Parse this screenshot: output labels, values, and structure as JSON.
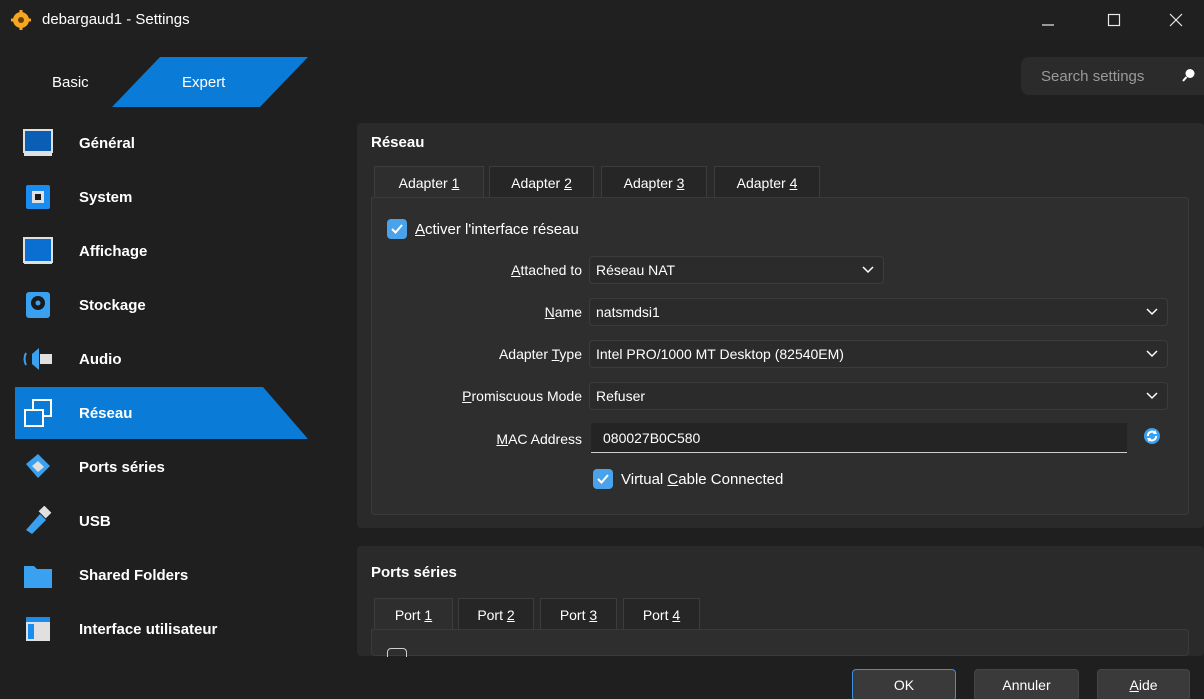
{
  "window": {
    "title": "debargaud1 - Settings"
  },
  "mode": {
    "basic": "Basic",
    "expert": "Expert"
  },
  "search": {
    "placeholder": "Search settings"
  },
  "sidebar": {
    "items": [
      {
        "label": "Général",
        "icon": "monitor-icon"
      },
      {
        "label": "System",
        "icon": "chip-icon"
      },
      {
        "label": "Affichage",
        "icon": "display-icon"
      },
      {
        "label": "Stockage",
        "icon": "disk-icon"
      },
      {
        "label": "Audio",
        "icon": "speaker-icon"
      },
      {
        "label": "Réseau",
        "icon": "network-icon",
        "selected": true
      },
      {
        "label": "Ports séries",
        "icon": "serial-port-icon"
      },
      {
        "label": "USB",
        "icon": "usb-icon"
      },
      {
        "label": "Shared Folders",
        "icon": "folder-icon"
      },
      {
        "label": "Interface utilisateur",
        "icon": "ui-window-icon"
      }
    ]
  },
  "network": {
    "title": "Réseau",
    "tabs": [
      {
        "prefix": "Adapter ",
        "key": "1"
      },
      {
        "prefix": "Adapter ",
        "key": "2"
      },
      {
        "prefix": "Adapter ",
        "key": "3"
      },
      {
        "prefix": "Adapter ",
        "key": "4"
      }
    ],
    "enable": {
      "key": "A",
      "rest": "ctiver l'interface réseau"
    },
    "attached": {
      "key": "A",
      "rest": "ttached to",
      "value": "Réseau NAT"
    },
    "name": {
      "key": "N",
      "rest": "ame",
      "value": "natsmdsi1"
    },
    "adapter_type": {
      "pre": "Adapter ",
      "key": "T",
      "rest": "ype",
      "value": "Intel PRO/1000 MT Desktop (82540EM)"
    },
    "promiscuous": {
      "key": "P",
      "rest": "romiscuous Mode",
      "value": "Refuser"
    },
    "mac": {
      "key": "M",
      "rest": "AC Address",
      "value": "080027B0C580"
    },
    "cable": {
      "pre": "Virtual ",
      "key": "C",
      "rest": "able Connected"
    }
  },
  "serial": {
    "title": "Ports séries",
    "tabs": [
      {
        "prefix": "Port ",
        "key": "1"
      },
      {
        "prefix": "Port ",
        "key": "2"
      },
      {
        "prefix": "Port ",
        "key": "3"
      },
      {
        "prefix": "Port ",
        "key": "4"
      }
    ]
  },
  "buttons": {
    "ok": "OK",
    "cancel": "Annuler",
    "help_key": "A",
    "help_rest": "ide"
  },
  "colors": {
    "accent": "#0a7cd8",
    "background": "#1f1f1f",
    "panel": "#2a2a2a"
  }
}
